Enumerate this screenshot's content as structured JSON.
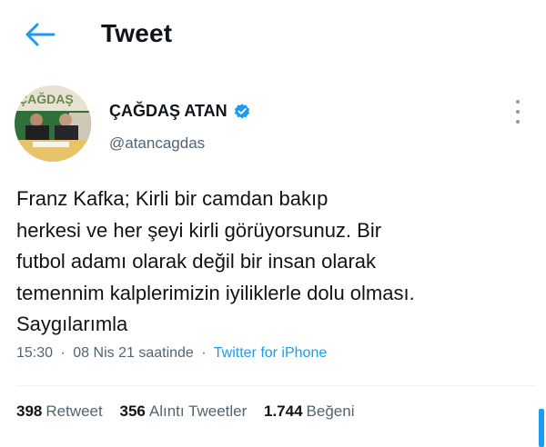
{
  "header": {
    "title": "Tweet",
    "back_icon": "arrow-left-icon"
  },
  "author": {
    "name": "ÇAĞDAŞ ATAN",
    "handle": "@atancagdas",
    "verified_icon": "verified-badge-icon",
    "avatar_text": "ÇAĞDAŞ"
  },
  "tweet": {
    "lines": [
      "Franz Kafka; Kirli bir camdan bakıp",
      "herkesi ve her şeyi kirli görüyorsunuz. Bir",
      "futbol adamı olarak değil bir insan olarak",
      "temennim kalplerimizin iyiliklerle dolu olması.",
      "Saygılarımla"
    ],
    "time": "15:30",
    "date": "08 Nis 21 saatinde",
    "source": "Twitter for iPhone",
    "separator": "·"
  },
  "stats": {
    "retweets_count": "398",
    "retweets_label": "Retweet",
    "quotes_count": "356",
    "quotes_label": "Alıntı Tweetler",
    "likes_count": "1.744",
    "likes_label": "Beğeni"
  },
  "colors": {
    "accent": "#1d9bf0",
    "text": "#0f1419",
    "secondary": "#536471"
  }
}
